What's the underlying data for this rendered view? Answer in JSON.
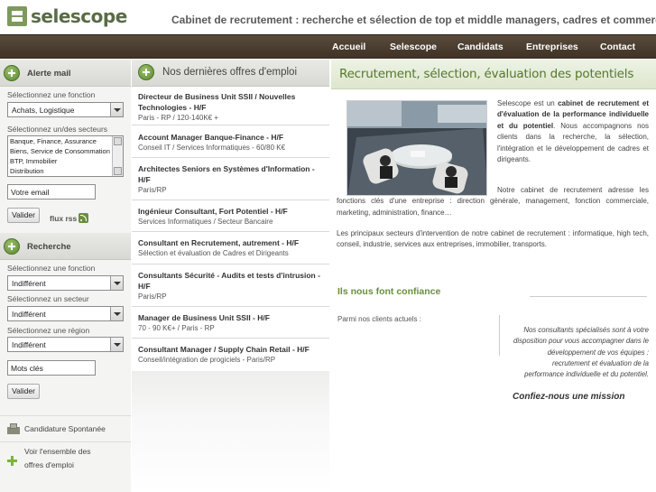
{
  "header": {
    "logo_text": "selescope",
    "tagline": "Cabinet de recrutement : recherche et sélection de top et middle managers, cadres et commerciaux."
  },
  "nav": {
    "items": [
      "Accueil",
      "Selescope",
      "Candidats",
      "Entreprises",
      "Contact"
    ]
  },
  "alerte": {
    "title": "Alerte mail",
    "fonction_label": "Sélectionnez une fonction",
    "fonction_value": "Achats, Logistique",
    "secteurs_label": "Sélectionnez un/des secteurs",
    "secteurs_options": [
      "Banque, Finance, Assurance",
      "Biens, Service de Consommation",
      "BTP, Immobilier",
      "Distribution"
    ],
    "email_placeholder": "Votre email",
    "submit": "Valider",
    "rss_label": "flux rss"
  },
  "recherche": {
    "title": "Recherche",
    "fonction_label": "Sélectionnez une fonction",
    "fonction_value": "Indifférent",
    "secteur_label": "Sélectionnez un secteur",
    "secteur_value": "Indifférent",
    "region_label": "Sélectionnez une région",
    "region_value": "Indifférent",
    "keywords_placeholder": "Mots clés",
    "submit": "Valider"
  },
  "side_links": {
    "candidature": "Candidature Spontanée",
    "offres_line1": "Voir l'ensemble des",
    "offres_line2": "offres d'emploi"
  },
  "offres": {
    "title": "Nos dernières offres d'emploi",
    "items": [
      {
        "title": "Directeur de Business Unit SSII / Nouvelles Technologies - H/F",
        "sub": "Paris - RP / 120-140K€ +"
      },
      {
        "title": "Account Manager Banque-Finance - H/F",
        "sub": "Conseil IT / Services Informatiques - 60/80 K€"
      },
      {
        "title": "Architectes Seniors en Systèmes d'Information - H/F",
        "sub": "Paris/RP"
      },
      {
        "title": "Ingénieur Consultant, Fort Potentiel - H/F",
        "sub": "Services Informatiques / Secteur Bancaire"
      },
      {
        "title": "Consultant en Recrutement, autrement - H/F",
        "sub": "Sélection et évaluation de Cadres et Dirigeants"
      },
      {
        "title": "Consultants Sécurité - Audits et tests d'intrusion - H/F",
        "sub": "Paris/RP"
      },
      {
        "title": "Manager de Business Unit SSII - H/F",
        "sub": "70 - 90 K€+ / Paris - RP"
      },
      {
        "title": "Consultant Manager / Supply Chain Retail - H/F",
        "sub": "Conseil/intégration de progiciels - Paris/RP"
      }
    ]
  },
  "main": {
    "title": "Recrutement, sélection, évaluation des potentiels",
    "intro_pre": "Selescope est un ",
    "intro_bold": "cabinet de recrutement et d'évaluation de la performance individuelle et du potentiel",
    "intro_post": ". Nous accompagnons nos clients dans la recherche, la sélection, l'intégration et le développement de cadres et dirigeants.",
    "para2": "Notre cabinet de recrutement adresse les fonctions clés d'une entreprise : direction générale, management, fonction commerciale, marketing, administration, finance…",
    "para3": "Les principaux secteurs d'intervention de notre cabinet de recrutement : informatique, high tech, conseil, industrie, services aux entreprises, immobilier, transports.",
    "confiance_title": "Ils nous font confiance",
    "clients_label": "Parmi nos clients actuels :",
    "consultants_text": "Nos consultants spécialisés sont à votre disposition pour vous accompagner dans le développement de vos équipes : recrutement et évaluation de la performance individuelle et du potentiel.",
    "cta": "Confiez-nous une mission"
  },
  "colors": {
    "brand_green": "#6a8e3c",
    "nav_brown": "#4a3c2e",
    "logo_text": "#5a6b46"
  }
}
